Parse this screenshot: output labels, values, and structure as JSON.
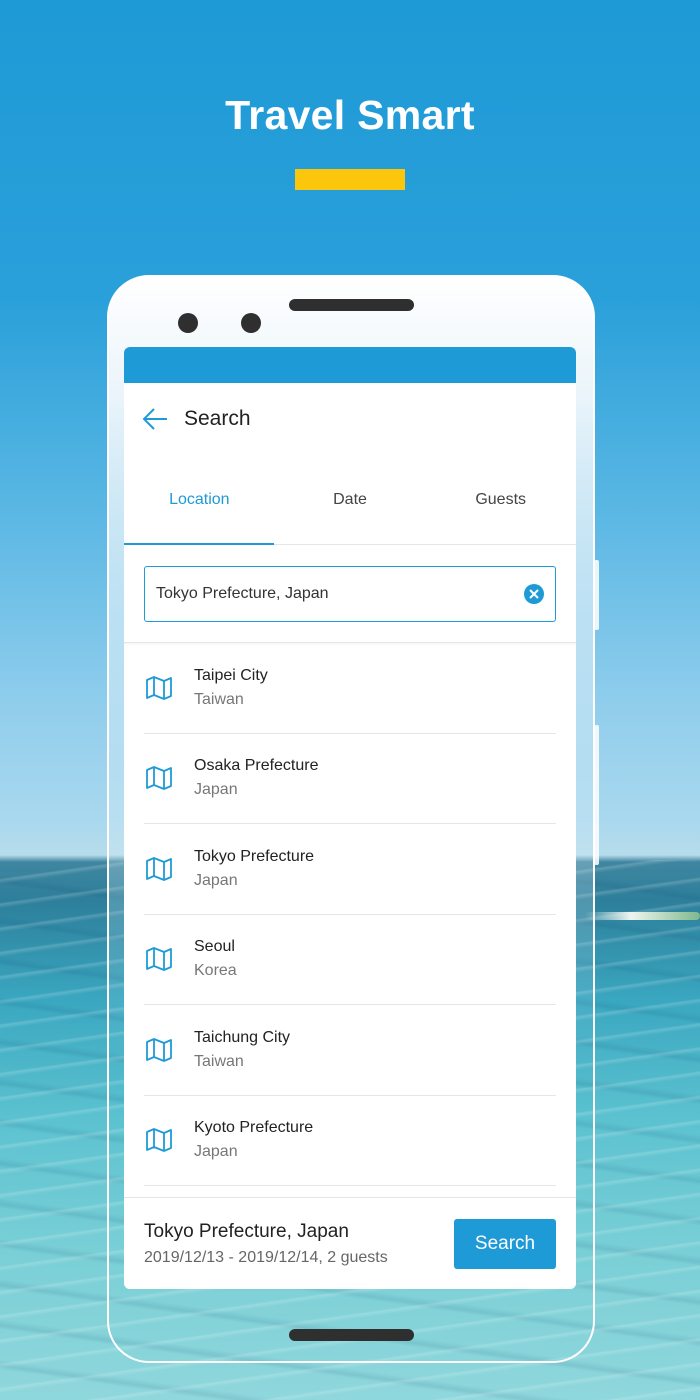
{
  "hero": {
    "title": "Travel Smart",
    "accent_color": "#fcc60d"
  },
  "app": {
    "primary_color": "#1e9ad6",
    "title": "Search",
    "back_icon": "arrow-left-icon"
  },
  "tabs": [
    {
      "label": "Location",
      "active": true
    },
    {
      "label": "Date",
      "active": false
    },
    {
      "label": "Guests",
      "active": false
    }
  ],
  "search": {
    "value": "Tokyo Prefecture, Japan",
    "clear_icon": "clear-circle-icon"
  },
  "results": [
    {
      "name": "Taipei City",
      "country": "Taiwan",
      "icon": "map-icon"
    },
    {
      "name": "Osaka Prefecture",
      "country": "Japan",
      "icon": "map-icon"
    },
    {
      "name": "Tokyo Prefecture",
      "country": "Japan",
      "icon": "map-icon"
    },
    {
      "name": "Seoul",
      "country": "Korea",
      "icon": "map-icon"
    },
    {
      "name": "Taichung City",
      "country": "Taiwan",
      "icon": "map-icon"
    },
    {
      "name": "Kyoto Prefecture",
      "country": "Japan",
      "icon": "map-icon"
    }
  ],
  "summary": {
    "location": "Tokyo Prefecture, Japan",
    "details": "2019/12/13 - 2019/12/14, 2 guests",
    "button_label": "Search"
  }
}
